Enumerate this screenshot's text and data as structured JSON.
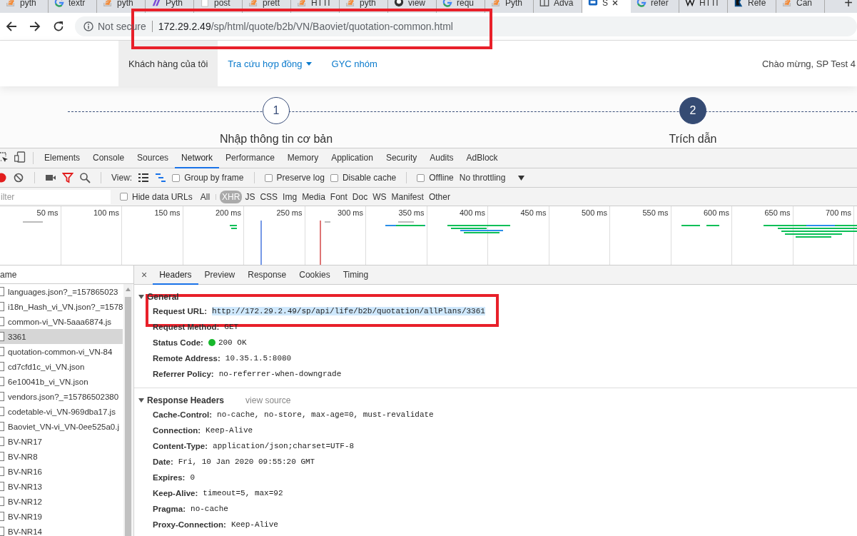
{
  "browser_tabs": [
    {
      "title": "pyth",
      "kind": "stack",
      "selected": false
    },
    {
      "title": "textr",
      "kind": "google",
      "selected": false
    },
    {
      "title": "pyth",
      "kind": "stack",
      "selected": false
    },
    {
      "title": "Pyth",
      "kind": "logo",
      "selected": false
    },
    {
      "title": "post",
      "kind": "page",
      "selected": false
    },
    {
      "title": "prett",
      "kind": "stack",
      "selected": false
    },
    {
      "title": "HTTI",
      "kind": "stack",
      "selected": false
    },
    {
      "title": "pyth",
      "kind": "stack",
      "selected": false
    },
    {
      "title": "view",
      "kind": "globe",
      "selected": false
    },
    {
      "title": "requ",
      "kind": "google",
      "selected": false
    },
    {
      "title": "Pyth",
      "kind": "stack",
      "selected": false
    },
    {
      "title": "Adva",
      "kind": "book",
      "selected": false
    },
    {
      "title": "S",
      "kind": "shop",
      "selected": true
    },
    {
      "title": "refer",
      "kind": "google",
      "selected": false
    },
    {
      "title": "HTTI",
      "kind": "wiki",
      "selected": false
    },
    {
      "title": "Refe",
      "kind": "flag",
      "selected": false
    },
    {
      "title": "Can",
      "kind": "stack",
      "selected": false
    }
  ],
  "new_tab": "+",
  "address_bar": {
    "security": "Not secure",
    "url_host": "172.29.2.49",
    "url_path": "/sp/html/quote/b2b/VN/Baoviet/quotation-common.html"
  },
  "site_nav": {
    "items": [
      {
        "label": "Khách hàng của tôi",
        "selected": true,
        "dropdown": false
      },
      {
        "label": "Tra cứu hợp đồng",
        "selected": false,
        "dropdown": true
      },
      {
        "label": "GYC nhóm",
        "selected": false,
        "dropdown": false
      }
    ],
    "greeting": "Chào mừng, SP Test 4"
  },
  "stepper": [
    {
      "number": "1",
      "label": "Nhập thông tin cơ bản",
      "selected": false
    },
    {
      "number": "2",
      "label": "Trích dẫn",
      "selected": true
    }
  ],
  "devtools": {
    "panels": [
      {
        "label": "Elements",
        "selected": false
      },
      {
        "label": "Console",
        "selected": false
      },
      {
        "label": "Sources",
        "selected": false
      },
      {
        "label": "Network",
        "selected": true
      },
      {
        "label": "Performance",
        "selected": false
      },
      {
        "label": "Memory",
        "selected": false
      },
      {
        "label": "Application",
        "selected": false
      },
      {
        "label": "Security",
        "selected": false
      },
      {
        "label": "Audits",
        "selected": false
      },
      {
        "label": "AdBlock",
        "selected": false
      }
    ],
    "toolbar": {
      "view_label": "View:",
      "options": [
        {
          "label": "Group by frame",
          "checked": false
        },
        {
          "label": "Preserve log",
          "checked": false
        },
        {
          "label": "Disable cache",
          "checked": false
        },
        {
          "label": "Offline",
          "checked": false
        }
      ],
      "throttling": "No throttling"
    },
    "filter": {
      "placeholder": "ilter",
      "hide_data_urls": {
        "label": "Hide data URLs",
        "checked": false
      },
      "types": [
        {
          "label": "All",
          "selected": false
        },
        {
          "label": "XHR",
          "selected": true
        },
        {
          "label": "JS",
          "selected": false
        },
        {
          "label": "CSS",
          "selected": false
        },
        {
          "label": "Img",
          "selected": false
        },
        {
          "label": "Media",
          "selected": false
        },
        {
          "label": "Font",
          "selected": false
        },
        {
          "label": "Doc",
          "selected": false
        },
        {
          "label": "WS",
          "selected": false
        },
        {
          "label": "Manifest",
          "selected": false
        },
        {
          "label": "Other",
          "selected": false
        }
      ]
    },
    "timeline": {
      "ticks": [
        "50 ms",
        "100 ms",
        "150 ms",
        "200 ms",
        "250 ms",
        "300 ms",
        "350 ms",
        "400 ms",
        "450 ms",
        "500 ms",
        "550 ms",
        "600 ms",
        "650 ms",
        "700 ms"
      ]
    },
    "requests": {
      "column": "ame",
      "rows": [
        {
          "name": "languages.json?_=157865023",
          "selected": false
        },
        {
          "name": "i18n_Hash_vi_VN.json?_=1578",
          "selected": false
        },
        {
          "name": "common-vi_VN-5aaa6874.js",
          "selected": false
        },
        {
          "name": "3361",
          "selected": true
        },
        {
          "name": "quotation-common-vi_VN-84",
          "selected": false
        },
        {
          "name": "cd7cfd1c_vi_VN.json",
          "selected": false
        },
        {
          "name": "6e10041b_vi_VN.json",
          "selected": false
        },
        {
          "name": "vendors.json?_=15786502380",
          "selected": false
        },
        {
          "name": "codetable-vi_VN-969dba17.js",
          "selected": false
        },
        {
          "name": "Baoviet_VN-vi_VN-0ee525a0.j",
          "selected": false
        },
        {
          "name": "BV-NR17",
          "selected": false
        },
        {
          "name": "BV-NR8",
          "selected": false
        },
        {
          "name": "BV-NR16",
          "selected": false
        },
        {
          "name": "BV-NR13",
          "selected": false
        },
        {
          "name": "BV-NR12",
          "selected": false
        },
        {
          "name": "BV-NR19",
          "selected": false
        },
        {
          "name": "BV-NR14",
          "selected": false
        }
      ]
    },
    "details": {
      "close": "×",
      "tabs": [
        {
          "label": "Headers",
          "selected": true
        },
        {
          "label": "Preview",
          "selected": false
        },
        {
          "label": "Response",
          "selected": false
        },
        {
          "label": "Cookies",
          "selected": false
        },
        {
          "label": "Timing",
          "selected": false
        }
      ],
      "sections": [
        {
          "title": "General",
          "expanded": true,
          "rows": [
            {
              "key": "Request URL:",
              "value": "http://172.29.2.49/sp/api/life/b2b/quotation/allPlans/3361",
              "kind": "highlighted"
            },
            {
              "key": "Request Method:",
              "value": "GET",
              "kind": "plain"
            },
            {
              "key": "Status Code:",
              "value": "200 OK",
              "kind": "status"
            },
            {
              "key": "Remote Address:",
              "value": "10.35.1.5:8080",
              "kind": "plain"
            },
            {
              "key": "Referrer Policy:",
              "value": "no-referrer-when-downgrade",
              "kind": "plain"
            }
          ]
        },
        {
          "title": "Response Headers",
          "link": "view source",
          "expanded": true,
          "rows": [
            {
              "key": "Cache-Control:",
              "value": "no-cache, no-store, max-age=0, must-revalidate",
              "kind": "plain"
            },
            {
              "key": "Connection:",
              "value": "Keep-Alive",
              "kind": "plain"
            },
            {
              "key": "Content-Type:",
              "value": "application/json;charset=UTF-8",
              "kind": "plain"
            },
            {
              "key": "Date:",
              "value": "Fri, 10 Jan 2020 09:55:20 GMT",
              "kind": "plain"
            },
            {
              "key": "Expires:",
              "value": "0",
              "kind": "plain"
            },
            {
              "key": "Keep-Alive:",
              "value": "timeout=5, max=92",
              "kind": "plain"
            },
            {
              "key": "Pragma:",
              "value": "no-cache",
              "kind": "plain"
            },
            {
              "key": "Proxy-Connection:",
              "value": "Keep-Alive",
              "kind": "plain"
            }
          ]
        }
      ]
    }
  }
}
